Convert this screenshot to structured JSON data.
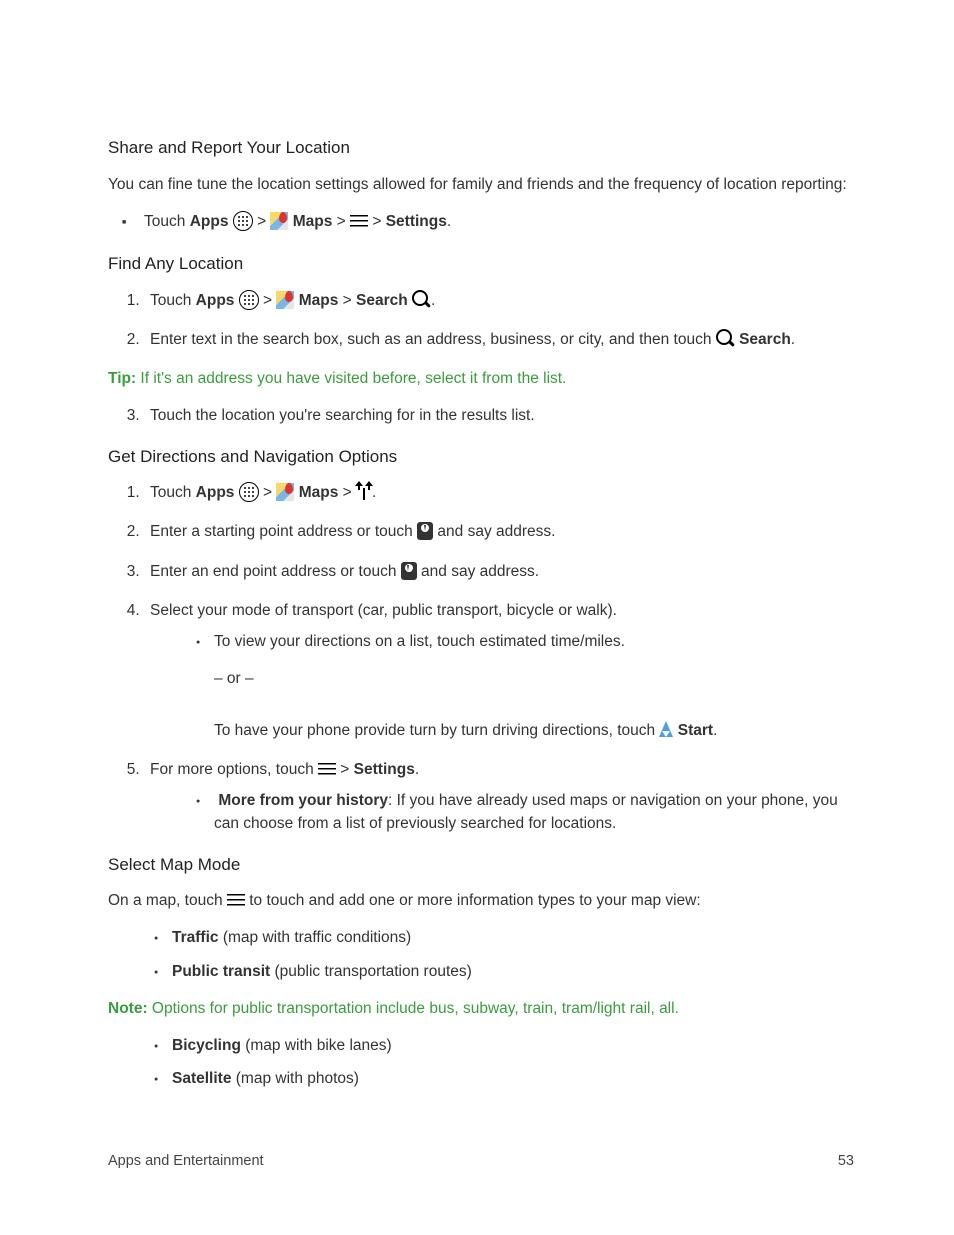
{
  "sec1": {
    "title": "Share and Report Your Location",
    "intro": "You can fine tune the location settings allowed for family and friends and the frequency of location reporting:",
    "bullet_pre": "Touch ",
    "apps": "Apps",
    "maps": "Maps",
    "settings": "Settings",
    "gt": " > "
  },
  "sec2": {
    "title": "Find Any Location",
    "step1_pre": "Touch ",
    "apps": "Apps",
    "maps": "Maps",
    "search": "Search",
    "step2_pre": "Enter text in the search box, such as an address, business, or city, and then touch ",
    "step2_search": "Search",
    "tip_label": "Tip:",
    "tip_text": " If it's an address you have visited before, select it from the list.",
    "step3": "Touch the location you're searching for in the results list.",
    "gt": " > "
  },
  "sec3": {
    "title": "Get Directions and Navigation Options",
    "step1_pre": "Touch ",
    "apps": "Apps",
    "maps": "Maps",
    "step2a": "Enter a starting point address or touch ",
    "step2b": " and say address.",
    "step3a": "Enter an end point address or touch ",
    "step3b": " and say address.",
    "step4": "Select your mode of transport (car, public transport, bicycle or walk).",
    "step4_sub": "To view your directions on a list, touch estimated time/miles.",
    "or": "– or –",
    "step4_sub2a": "To have your phone provide turn by turn driving directions, touch ",
    "start": "Start",
    "step5a": "For more options, touch ",
    "settings": "Settings",
    "step5_sub_b": "More from your history",
    "step5_sub_t": ": If you have already used maps or navigation on your phone, you can choose from a list of previously searched for locations.",
    "gt": " > "
  },
  "sec4": {
    "title": "Select Map Mode",
    "intro_a": "On a map, touch ",
    "intro_b": " to touch and add one or more information types to your map view:",
    "b1b": "Traffic",
    "b1t": " (map with traffic conditions)",
    "b2b": "Public transit",
    "b2t": " (public transportation routes)",
    "note_label": "Note:",
    "note_text": " Options for public transportation include bus, subway, train, tram/light rail, all.",
    "b3b": "Bicycling",
    "b3t": " (map with bike lanes)",
    "b4b": "Satellite",
    "b4t": " (map with photos)"
  },
  "footer": {
    "left": "Apps and Entertainment",
    "right": "53"
  },
  "period": "."
}
